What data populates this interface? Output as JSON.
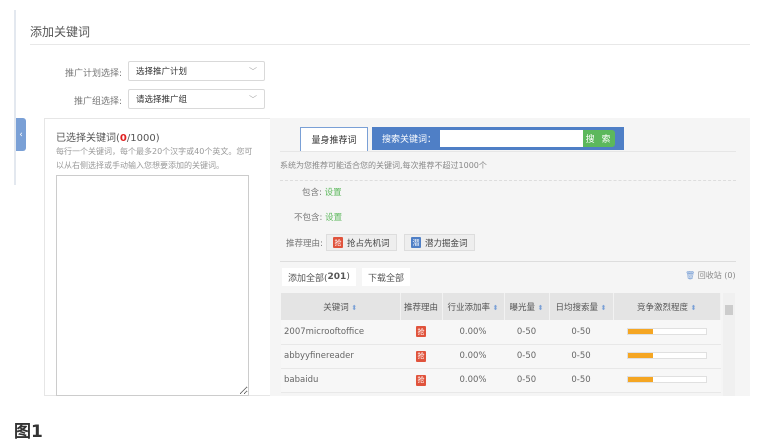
{
  "title": "添加关键词",
  "plan": {
    "label": "推广计划选择:",
    "value": "选择推广计划"
  },
  "group": {
    "label": "推广组选择:",
    "value": "请选择推广组"
  },
  "selected": {
    "label": "已选择关键词(",
    "count": "0",
    "max": "/1000)",
    "hint": "每行一个关键词，每个最多20个汉字或40个英文。您可以从右侧选择或手动输入您想要添加的关键词。"
  },
  "tab_label": "量身推荐词",
  "search": {
    "label": "搜索关键词：",
    "value": "",
    "button": "搜 索"
  },
  "notice": "系统为您推荐可能适合您的关键词,每次推荐不超过1000个",
  "include": {
    "label": "包含:",
    "link": "设置"
  },
  "exclude": {
    "label": "不包含:",
    "link": "设置"
  },
  "reason": {
    "label": "推荐理由:",
    "buttons": [
      {
        "badge": "抢",
        "label": "抢占先机词",
        "color": "#e0533c"
      },
      {
        "badge": "潜",
        "label": "潜力掘金词",
        "color": "#4f7fc6"
      }
    ]
  },
  "actions": {
    "add_all": "添加全部(",
    "add_all_count": "201",
    "add_all_end": ")",
    "download_all": "下载全部",
    "recycle": "回收站 (0)"
  },
  "table": {
    "headers": [
      "关键词",
      "推荐理由",
      "行业添加率",
      "曝光量",
      "日均搜索量",
      "竞争激烈程度"
    ],
    "rows": [
      {
        "keyword": "2007microoftoffice",
        "reason": "抢",
        "rate": "0.00%",
        "exposure": "0-50",
        "daily": "0-50",
        "competition": 0.33
      },
      {
        "keyword": "abbyyfinereader",
        "reason": "抢",
        "rate": "0.00%",
        "exposure": "0-50",
        "daily": "0-50",
        "competition": 0.33
      },
      {
        "keyword": "babaidu",
        "reason": "抢",
        "rate": "0.00%",
        "exposure": "0-50",
        "daily": "0-50",
        "competition": 0.33
      }
    ]
  },
  "caption": "图1"
}
